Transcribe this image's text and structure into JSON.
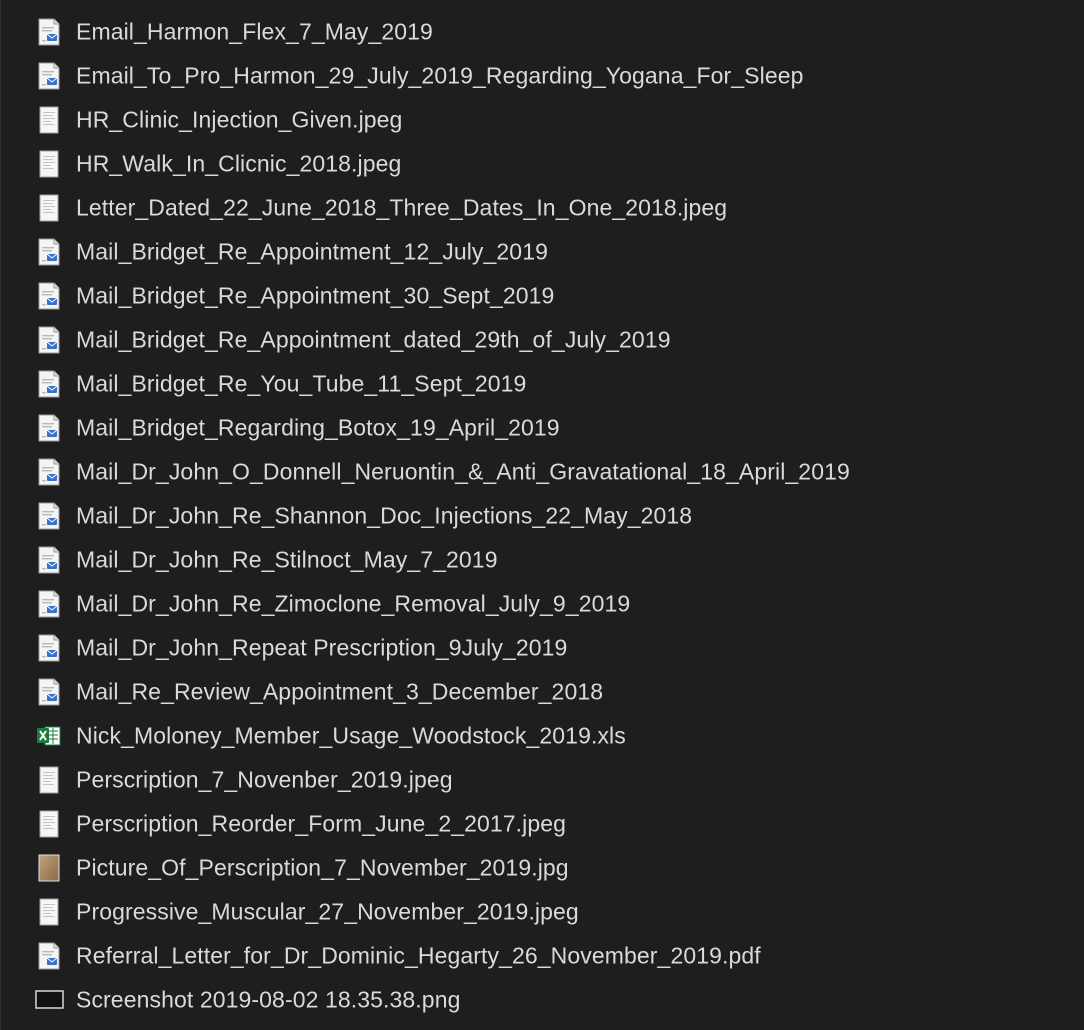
{
  "files": [
    {
      "name": "Email_Harmon_Flex_7_May_2019",
      "icon": "email-icon"
    },
    {
      "name": "Email_To_Pro_Harmon_29_July_2019_Regarding_Yogana_For_Sleep",
      "icon": "email-icon"
    },
    {
      "name": "HR_Clinic_Injection_Given.jpeg",
      "icon": "image-icon"
    },
    {
      "name": "HR_Walk_In_Clicnic_2018.jpeg",
      "icon": "image-icon"
    },
    {
      "name": "Letter_Dated_22_June_2018_Three_Dates_In_One_2018.jpeg",
      "icon": "image-icon"
    },
    {
      "name": "Mail_Bridget_Re_Appointment_12_July_2019",
      "icon": "email-icon"
    },
    {
      "name": "Mail_Bridget_Re_Appointment_30_Sept_2019",
      "icon": "email-icon"
    },
    {
      "name": "Mail_Bridget_Re_Appointment_dated_29th_of_July_2019",
      "icon": "email-icon"
    },
    {
      "name": "Mail_Bridget_Re_You_Tube_11_Sept_2019",
      "icon": "email-icon"
    },
    {
      "name": "Mail_Bridget_Regarding_Botox_19_April_2019",
      "icon": "email-icon"
    },
    {
      "name": "Mail_Dr_John_O_Donnell_Neruontin_&_Anti_Gravatational_18_April_2019",
      "icon": "email-icon"
    },
    {
      "name": "Mail_Dr_John_Re_Shannon_Doc_Injections_22_May_2018",
      "icon": "email-icon"
    },
    {
      "name": "Mail_Dr_John_Re_Stilnoct_May_7_2019",
      "icon": "email-icon"
    },
    {
      "name": "Mail_Dr_John_Re_Zimoclone_Removal_July_9_2019",
      "icon": "email-icon"
    },
    {
      "name": "Mail_Dr_John_Repeat Prescription_9July_2019",
      "icon": "email-icon"
    },
    {
      "name": "Mail_Re_Review_Appointment_3_December_2018",
      "icon": "email-icon"
    },
    {
      "name": "Nick_Moloney_Member_Usage_Woodstock_2019.xls",
      "icon": "excel-icon"
    },
    {
      "name": "Perscription_7_Novenber_2019.jpeg",
      "icon": "image-icon"
    },
    {
      "name": "Perscription_Reorder_Form_June_2_2017.jpeg",
      "icon": "image-icon"
    },
    {
      "name": "Picture_Of_Perscription_7_November_2019.jpg",
      "icon": "photo-icon"
    },
    {
      "name": "Progressive_Muscular_27_November_2019.jpeg",
      "icon": "image-icon"
    },
    {
      "name": "Referral_Letter_for_Dr_Dominic_Hegarty_26_November_2019.pdf",
      "icon": "pdf-icon"
    },
    {
      "name": "Screenshot 2019-08-02 18.35.38.png",
      "icon": "screenshot-icon"
    }
  ],
  "colors": {
    "background": "#1e1e1e",
    "text": "#dadada",
    "excel_green": "#1f7a3d",
    "email_blue": "#3a6fc4"
  }
}
